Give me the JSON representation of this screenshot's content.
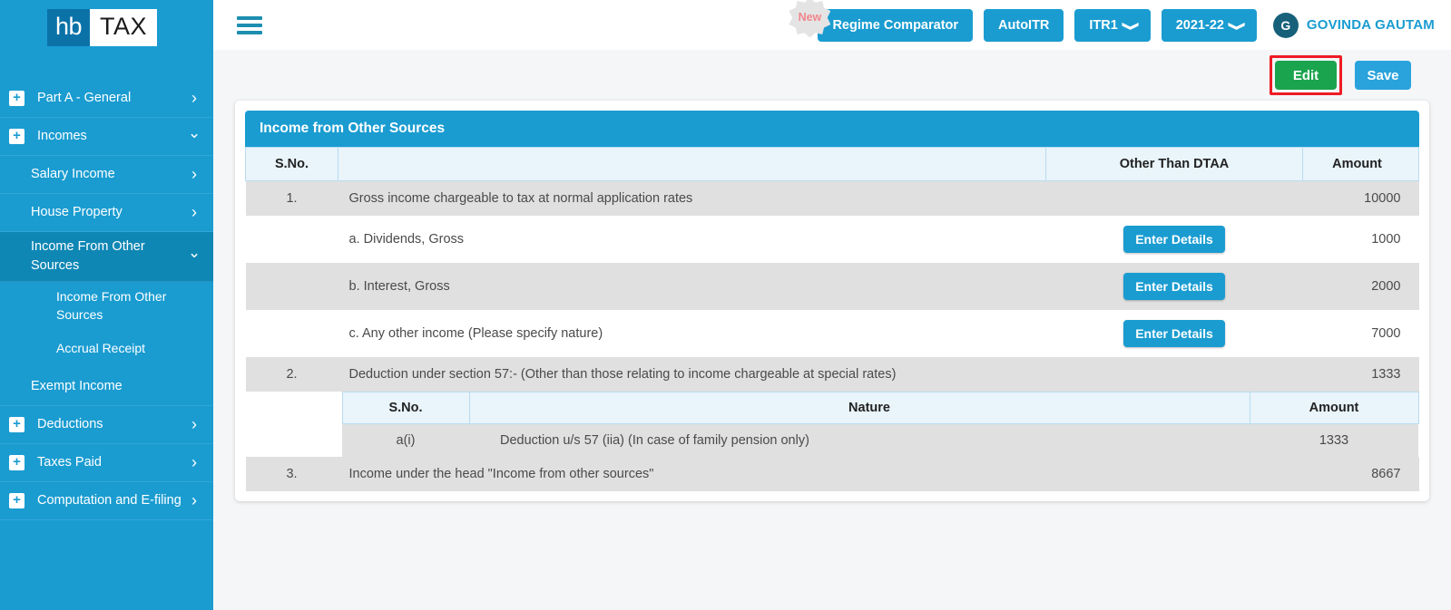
{
  "brand": {
    "mark": "hb",
    "name": "TAX"
  },
  "sidebar": {
    "items": [
      {
        "label": "Part A - General",
        "icon": "plus-box-icon",
        "chevron": "chevron-right-icon",
        "level": "top",
        "active": false
      },
      {
        "label": "Incomes",
        "icon": "plus-box-icon",
        "chevron": "chevron-down-icon",
        "level": "top",
        "active": false
      },
      {
        "label": "Salary Income",
        "chevron": "chevron-right-icon",
        "level": "sub",
        "active": false
      },
      {
        "label": "House Property",
        "chevron": "chevron-right-icon",
        "level": "sub",
        "active": false
      },
      {
        "label": "Income From Other Sources",
        "chevron": "chevron-down-icon",
        "level": "sub",
        "active": true
      },
      {
        "label": "Income From Other Sources",
        "level": "sub2",
        "active": false
      },
      {
        "label": "Accrual Receipt",
        "level": "sub2",
        "active": false
      },
      {
        "label": "Exempt Income",
        "level": "sub",
        "active": false
      },
      {
        "label": "Deductions",
        "icon": "plus-box-icon",
        "chevron": "chevron-right-icon",
        "level": "top",
        "active": false
      },
      {
        "label": "Taxes Paid",
        "icon": "plus-box-icon",
        "chevron": "chevron-right-icon",
        "level": "top",
        "active": false
      },
      {
        "label": "Computation and E-filing",
        "icon": "plus-box-icon",
        "chevron": "chevron-right-icon",
        "level": "top",
        "active": false
      }
    ]
  },
  "header": {
    "menu_icon": "hamburger-icon",
    "new_badge": "New",
    "regime_comparator": "Regime Comparator",
    "auto_itr": "AutoITR",
    "itr_form": "ITR1",
    "assessment_year": "2021-22",
    "avatar_initial": "G",
    "user_name": "GOVINDA GAUTAM"
  },
  "actions": {
    "edit": "Edit",
    "save": "Save"
  },
  "card": {
    "title": "Income from Other Sources",
    "columns": {
      "sno": "S.No.",
      "desc": "",
      "dtaa": "Other Than DTAA",
      "amount": "Amount"
    },
    "rows": [
      {
        "sno": "1.",
        "desc": "Gross income chargeable to tax at normal application rates",
        "button": "",
        "amount": "10000",
        "shade": true,
        "indent": false
      },
      {
        "sno": "",
        "desc": "a. Dividends, Gross",
        "button": "Enter Details",
        "amount": "1000",
        "shade": false,
        "indent": true
      },
      {
        "sno": "",
        "desc": "b. Interest, Gross",
        "button": "Enter Details",
        "amount": "2000",
        "shade": true,
        "indent": true
      },
      {
        "sno": "",
        "desc": "c. Any other income (Please specify nature)",
        "button": "Enter Details",
        "amount": "7000",
        "shade": false,
        "indent": true
      },
      {
        "sno": "2.",
        "desc": "Deduction under section 57:- (Other than those relating to income chargeable at special rates)",
        "button": "",
        "amount": "1333",
        "shade": true,
        "indent": false
      }
    ],
    "nested": {
      "columns": {
        "sno": "S.No.",
        "nature": "Nature",
        "amount": "Amount"
      },
      "rows": [
        {
          "sno": "a(i)",
          "nature": "Deduction u/s 57 (iia) (In case of family pension only)",
          "amount": "1333"
        }
      ]
    },
    "final_row": {
      "sno": "3.",
      "desc": "Income under the head \"Income from other sources\"",
      "amount": "8667"
    }
  },
  "colors": {
    "brand_blue": "#1a9cd1",
    "sidebar_active": "#0f87b5",
    "edit_green": "#1aa44e",
    "save_blue": "#2aa3dd",
    "highlight_red": "#ee1c25",
    "row_shade": "#e0e0e0",
    "table_header": "#e9f4fb"
  }
}
